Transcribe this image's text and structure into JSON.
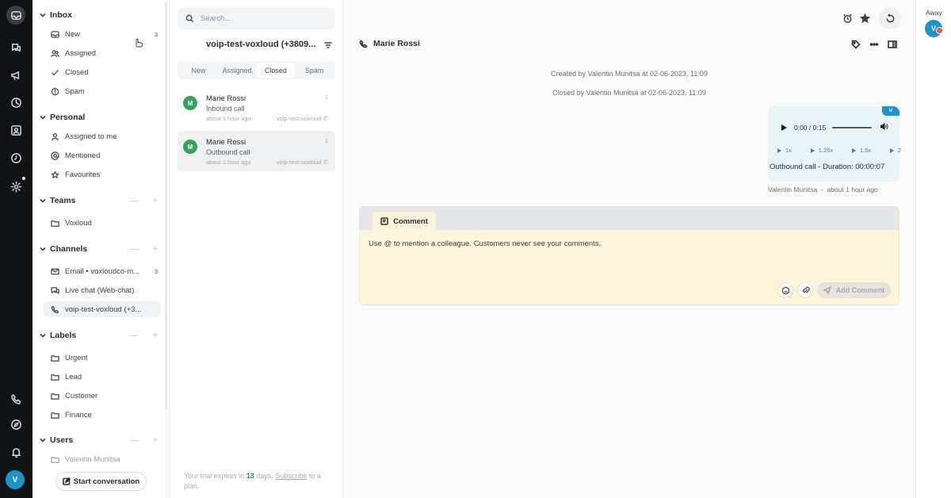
{
  "sidebar": {
    "inbox": {
      "title": "Inbox",
      "items": [
        {
          "label": "New",
          "count": "3"
        },
        {
          "label": "Assigned"
        },
        {
          "label": "Closed"
        },
        {
          "label": "Spam"
        }
      ]
    },
    "personal": {
      "title": "Personal",
      "items": [
        {
          "label": "Assigned to me"
        },
        {
          "label": "Mentioned"
        },
        {
          "label": "Favourites"
        }
      ]
    },
    "teams": {
      "title": "Teams",
      "items": [
        {
          "label": "Voxloud"
        }
      ]
    },
    "channels": {
      "title": "Channels",
      "items": [
        {
          "label": "Email • voxloudco-m...",
          "count": "3"
        },
        {
          "label": "Live chat (Web-chat)"
        },
        {
          "label": "voip-test-voxloud (+3..."
        }
      ]
    },
    "labels": {
      "title": "Labels",
      "items": [
        {
          "label": "Urgent"
        },
        {
          "label": "Lead"
        },
        {
          "label": "Customer"
        },
        {
          "label": "Finance"
        }
      ]
    },
    "users": {
      "title": "Users",
      "items": [
        {
          "label": "Valentin Munitsa"
        }
      ]
    },
    "start_conversation": "Start conversation"
  },
  "rail": {
    "avatar_initial": "V"
  },
  "conversation_list": {
    "search_placeholder": "Search...",
    "title": "voip-test-voxloud (+3809...",
    "tabs": [
      "New",
      "Assigned",
      "Closed",
      "Spam"
    ],
    "active_tab": "Closed",
    "conversations": [
      {
        "initial": "M",
        "name": "Marie Rossi",
        "subtitle": "Inbound call",
        "time": "about 1 hour ago",
        "inbox": "voip-test-voxloud",
        "number": "1"
      },
      {
        "initial": "M",
        "name": "Marie Rossi",
        "subtitle": "Outbound call",
        "time": "about 1 hour ago",
        "inbox": "voip-test-voxloud",
        "number": "1"
      }
    ],
    "trial": {
      "prefix": "Your trial expires in",
      "days": "13",
      "middle": "days.",
      "link": "Subscribe",
      "suffix": "to a plan."
    }
  },
  "conversation": {
    "contact_name": "Marie Rossi",
    "activity": [
      "Created by Valentin Munitsa at 02-06-2023, 11:09",
      "Closed by Valentin Munitsa at 02-06-2023, 11:09"
    ],
    "message": {
      "badge": "M",
      "audio_time": "0:00 / 0:15",
      "speeds": [
        "1x",
        "1.25x",
        "1.5x",
        "2"
      ],
      "text": "Outbound call - Duration: 00:00:07",
      "sender": "Valentin Munitsa",
      "time": "about 1 hour ago"
    },
    "reply": {
      "tab_label": "Comment",
      "placeholder": "Use @ to mention a colleague. Customers never see your comments.",
      "add_button": "Add Comment"
    }
  },
  "user": {
    "status": "Away",
    "initial": "V"
  },
  "colors": {
    "accent": "#1f93c9",
    "contact_avatar": "#3aa15a",
    "comment_bg": "#fcf5dc",
    "status_dot": "#e8554e"
  }
}
